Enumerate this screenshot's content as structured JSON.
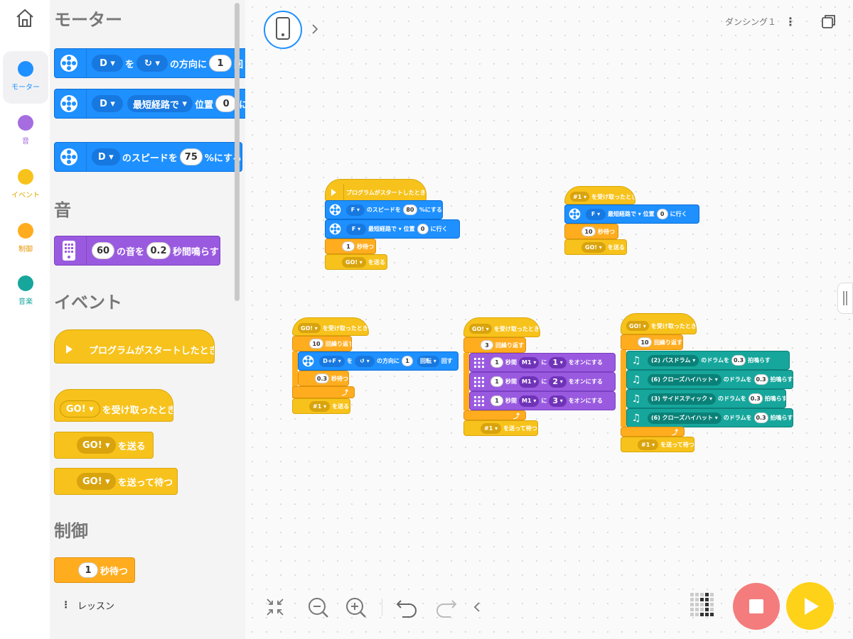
{
  "app": {
    "project_name": "ダンシング１"
  },
  "rail": {
    "categories": [
      {
        "label": "モーター",
        "color": "#1e90ff"
      },
      {
        "label": "音",
        "color": "#a66de0"
      },
      {
        "label": "イベント",
        "color": "#f7c21b"
      },
      {
        "label": "制御",
        "color": "#ffad1f"
      },
      {
        "label": "音楽",
        "color": "#16a69c"
      }
    ]
  },
  "palette": {
    "motor_heading": "モーター",
    "motor": {
      "b1": {
        "port": "D",
        "t1": "を",
        "t2": "の方向に",
        "amount": "1",
        "t3": "回"
      },
      "b2": {
        "port": "D",
        "path": "最短経路で",
        "t1": "位置",
        "pos": "0",
        "t2": "に"
      },
      "b3": {
        "port": "D",
        "t1": "のスピードを",
        "speed": "75",
        "t2": "%にする"
      }
    },
    "sound_heading": "音",
    "sound": {
      "note": "60",
      "t1": "の音を",
      "dur": "0.2",
      "t2": "秒間鳴らす"
    },
    "events_heading": "イベント",
    "events": {
      "start": "プログラムがスタートしたとき",
      "receive_msg": "GO!",
      "receive": "を受け取ったとき",
      "send_msg": "GO!",
      "send": "を送る",
      "sendwait_msg": "GO!",
      "sendwait": "を送って待つ"
    },
    "control_heading": "制御",
    "control": {
      "wait_val": "1",
      "wait": "秒待つ"
    },
    "lessons": "レッスン"
  },
  "scripts": {
    "s1": {
      "hat": "プログラムがスタートしたとき",
      "speed": {
        "port": "F",
        "t1": "のスピードを",
        "val": "80",
        "t2": "%にする"
      },
      "goto": {
        "port": "F",
        "path": "最短経路で",
        "t1": "位置",
        "val": "0",
        "t2": "に行く"
      },
      "wait": {
        "val": "1",
        "t": "秒待つ"
      },
      "send": {
        "msg": "GO!",
        "t": "を送る"
      }
    },
    "s2": {
      "hat": {
        "msg": "#1",
        "t": "を受け取ったとき"
      },
      "goto": {
        "port": "F",
        "path": "最短経路で",
        "t1": "位置",
        "val": "0",
        "t2": "に行く"
      },
      "wait": {
        "val": "10",
        "t": "秒待つ"
      },
      "send": {
        "msg": "GO!",
        "t": "を送る"
      }
    },
    "s3": {
      "hat": {
        "msg": "GO!",
        "t": "を受け取ったとき"
      },
      "repeat": {
        "val": "10",
        "t": "回繰り返す"
      },
      "run": {
        "port": "D+F",
        "t1": "を",
        "t2": "の方向に",
        "val": "1",
        "unit": "回転",
        "t3": "回す"
      },
      "wait": {
        "val": "0.3",
        "t": "秒待つ"
      },
      "send": {
        "msg": "#1",
        "t": "を送る"
      }
    },
    "s4": {
      "hat": {
        "msg": "GO!",
        "t": "を受け取ったとき"
      },
      "repeat": {
        "val": "3",
        "t": "回繰り返す"
      },
      "lights": [
        {
          "val": "1",
          "t1": "秒間",
          "matrix": "M1",
          "t2": "に",
          "t3": "をオンにする"
        },
        {
          "val": "1",
          "t1": "秒間",
          "matrix": "M1",
          "t2": "に",
          "t3": "をオンにする"
        },
        {
          "val": "1",
          "t1": "秒間",
          "matrix": "M1",
          "t2": "に",
          "t3": "をオンにする"
        }
      ],
      "sendwait": {
        "msg": "#1",
        "t": "を送って待つ"
      }
    },
    "s5": {
      "hat": {
        "msg": "GO!",
        "t": "を受け取ったとき"
      },
      "repeat": {
        "val": "10",
        "t": "回繰り返す"
      },
      "drums": [
        {
          "drum": "(2) バスドラム",
          "t1": "のドラムを",
          "val": "0.3",
          "t2": "拍鳴らす"
        },
        {
          "drum": "(6) クローズハイハット",
          "t1": "のドラムを",
          "val": "0.3",
          "t2": "拍鳴らす"
        },
        {
          "drum": "(3) サイドスティック",
          "t1": "のドラムを",
          "val": "0.3",
          "t2": "拍鳴らす"
        },
        {
          "drum": "(6) クローズハイハット",
          "t1": "のドラムを",
          "val": "0.3",
          "t2": "拍鳴らす"
        }
      ],
      "sendwait": {
        "msg": "#1",
        "t": "を送って待つ"
      }
    }
  },
  "icons": {
    "home": "home-icon",
    "device": "device-icon",
    "chevron": "chevron-right-icon",
    "more": "more-vertical-icon",
    "windows": "windows-icon",
    "collapse": "collapse-icon",
    "zoom_out": "zoom-out-icon",
    "zoom_in": "zoom-in-icon",
    "undo": "undo-icon",
    "redo": "redo-icon",
    "back": "chevron-left-icon",
    "matrix": "light-matrix-icon",
    "stop": "stop-icon",
    "play": "play-icon"
  }
}
